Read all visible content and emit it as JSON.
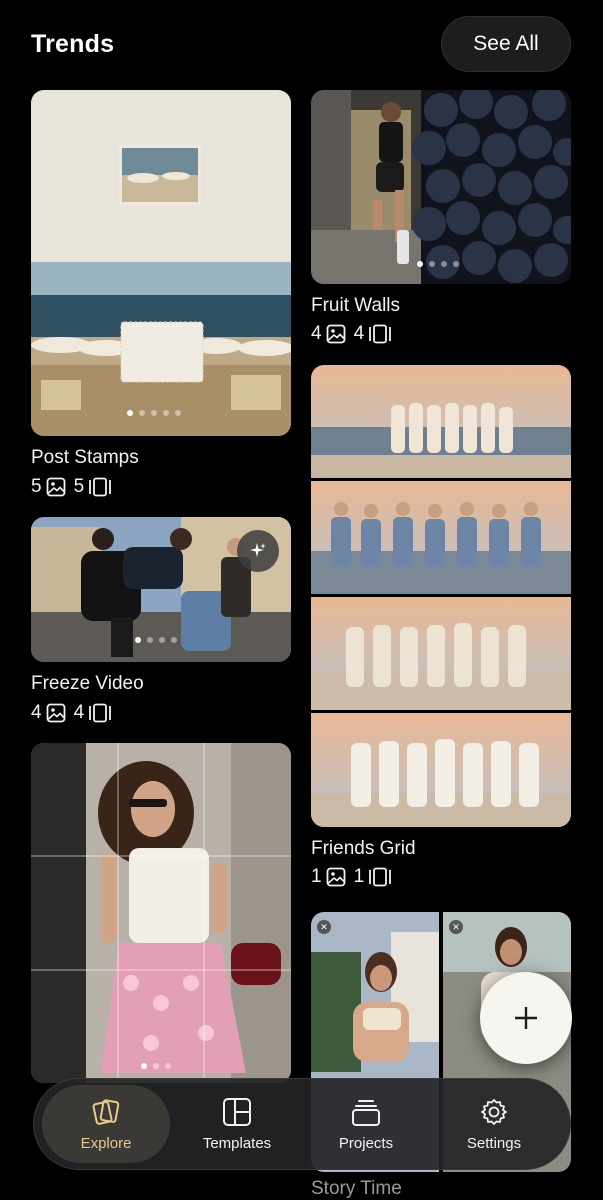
{
  "header": {
    "title": "Trends",
    "see_all": "See All"
  },
  "colors": {
    "background": "#000000",
    "accent": "#e8c98a",
    "fab": "#f7f5f0"
  },
  "trends": [
    {
      "name": "Post Stamps",
      "photos": "5",
      "slides": "5"
    },
    {
      "name": "Fruit Walls",
      "photos": "4",
      "slides": "4"
    },
    {
      "name": "Freeze Video",
      "photos": "4",
      "slides": "4"
    },
    {
      "name": "Friends Grid",
      "photos": "1",
      "slides": "1"
    },
    {
      "name": "Story Time"
    }
  ],
  "icons": {
    "photo": "photo-icon",
    "slides": "slides-icon",
    "sparkle": "sparkle-icon",
    "add": "plus-icon"
  },
  "tabs": [
    {
      "label": "Explore",
      "icon": "explore-cards-icon",
      "active": true
    },
    {
      "label": "Templates",
      "icon": "templates-grid-icon"
    },
    {
      "label": "Projects",
      "icon": "projects-stack-icon"
    },
    {
      "label": "Settings",
      "icon": "gear-icon"
    }
  ]
}
